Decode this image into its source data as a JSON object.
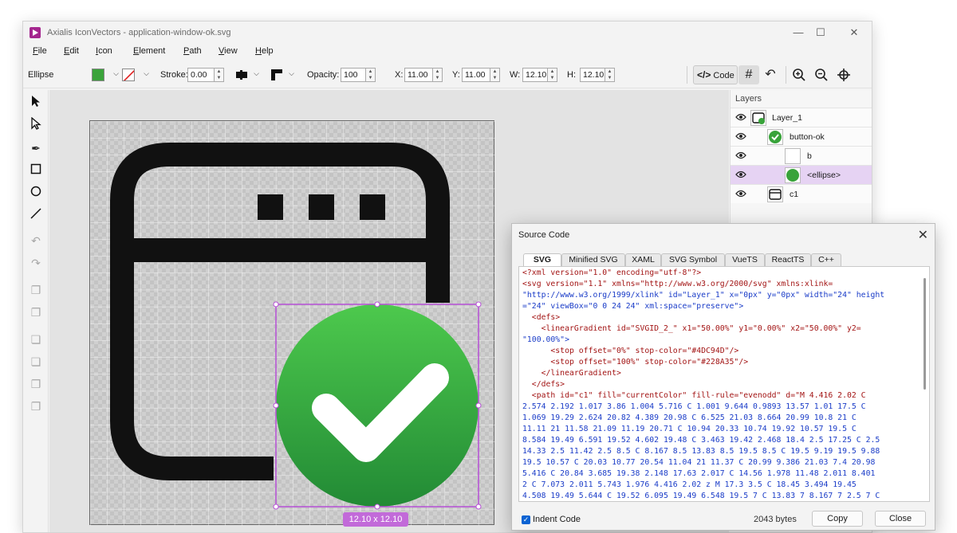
{
  "window": {
    "title": "Axialis IconVectors - application-window-ok.svg",
    "minimize": "—",
    "maximize": "☐",
    "close": "✕"
  },
  "menu": [
    "File",
    "Edit",
    "Icon",
    "Element",
    "Path",
    "View",
    "Help"
  ],
  "toolbar": {
    "shape_name": "Ellipse",
    "fill_color": "#3aa33a",
    "stroke_label": "Stroke:",
    "stroke_value": "0.00",
    "opacity_label": "Opacity:",
    "opacity_value": "100",
    "x_label": "X:",
    "x_value": "11.00",
    "y_label": "Y:",
    "y_value": "11.00",
    "w_label": "W:",
    "w_value": "12.10",
    "h_label": "H:",
    "h_value": "12.10",
    "code_label": "Code"
  },
  "canvas": {
    "selection_size": "12.10 x 12.10",
    "icon_color": "#111111",
    "gradient_start": "#4DC94D",
    "gradient_end": "#228A35"
  },
  "layers": {
    "title": "Layers",
    "items": [
      {
        "name": "Layer_1",
        "icon": "layer-icon"
      },
      {
        "name": "button-ok",
        "icon": "check-circle-icon"
      },
      {
        "name": "b",
        "icon": "blank-icon"
      },
      {
        "name": "<ellipse>",
        "icon": "ellipse-icon"
      },
      {
        "name": "c1",
        "icon": "window-icon"
      }
    ]
  },
  "source_dialog": {
    "title": "Source Code",
    "tabs": [
      "SVG",
      "Minified SVG",
      "XAML",
      "SVG Symbol",
      "VueTS",
      "ReactTS",
      "C++"
    ],
    "active_tab": "SVG",
    "indent_label": "Indent Code",
    "bytes": "2043 bytes",
    "copy_label": "Copy",
    "close_label": "Close",
    "code": {
      "l1": "<?xml version=\"1.0\" encoding=\"utf-8\"?>",
      "l2": "<svg version=\"1.1\" xmlns=\"http://www.w3.org/2000/svg\" xmlns:xlink=",
      "l3": "\"http://www.w3.org/1999/xlink\" id=\"Layer_1\" x=\"0px\" y=\"0px\" width=\"24\" height",
      "l4": "=\"24\" viewBox=\"0 0 24 24\" xml:space=\"preserve\">",
      "l5": "  <defs>",
      "l6": "    <linearGradient id=\"SVGID_2_\" x1=\"50.00%\" y1=\"0.00%\" x2=\"50.00%\" y2=",
      "l7": "\"100.00%\">",
      "l8": "      <stop offset=\"0%\" stop-color=\"#4DC94D\"/>",
      "l9": "      <stop offset=\"100%\" stop-color=\"#228A35\"/>",
      "l10": "    </linearGradient>",
      "l11": "  </defs>",
      "l12": "  <path id=\"c1\" fill=\"currentColor\" fill-rule=\"evenodd\" d=\"M 4.416 2.02 C",
      "l13": "2.574 2.192 1.017 3.86 1.004 5.716 C 1.001 9.644 0.9893 13.57 1.01 17.5 C",
      "l14": "1.069 19.29 2.624 20.82 4.389 20.98 C 6.525 21.03 8.664 20.99 10.8 21 C",
      "l15": "11.11 21 11.58 21.09 11.19 20.71 C 10.94 20.33 10.74 19.92 10.57 19.5 C",
      "l16": "8.584 19.49 6.591 19.52 4.602 19.48 C 3.463 19.42 2.468 18.4 2.5 17.25 C 2.5",
      "l17": "14.33 2.5 11.42 2.5 8.5 C 8.167 8.5 13.83 8.5 19.5 8.5 C 19.5 9.19 19.5 9.88",
      "l18": "19.5 10.57 C 20.03 10.77 20.54 11.04 21 11.37 C 20.99 9.386 21.03 7.4 20.98",
      "l19": "5.416 C 20.84 3.685 19.38 2.148 17.63 2.017 C 14.56 1.978 11.48 2.011 8.401",
      "l20": "2 C 7.073 2.011 5.743 1.976 4.416 2.02 z M 17.3 3.5 C 18.45 3.494 19.45",
      "l21": "4.508 19.49 5.644 C 19.52 6.095 19.49 6.548 19.5 7 C 13.83 7 8.167 7 2.5 7 C"
    }
  }
}
